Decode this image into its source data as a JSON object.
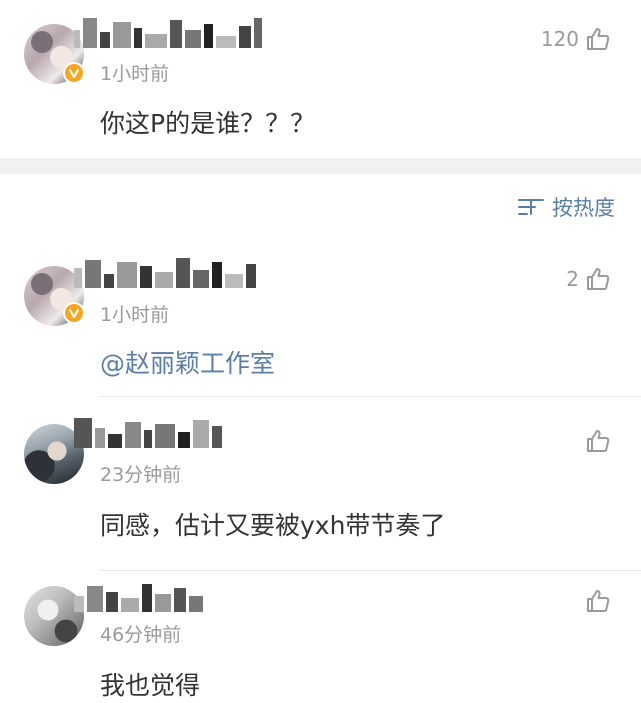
{
  "top_comment": {
    "time": "1小时前",
    "text": "你这P的是谁？？？",
    "likes": "120",
    "verified": true
  },
  "sort": {
    "label": "按热度"
  },
  "replies": [
    {
      "time": "1小时前",
      "text": "@赵丽颖工作室",
      "likes": "2",
      "verified": true
    },
    {
      "time": "23分钟前",
      "text": "同感，估计又要被yxh带节奏了",
      "likes": "",
      "verified": false
    },
    {
      "time": "46分钟前",
      "text": "我也觉得",
      "likes": "",
      "verified": false
    }
  ],
  "colors": {
    "link": "#5b7ea8",
    "muted": "#9a9a9a",
    "text": "#333333",
    "verified_badge": "#f5a623",
    "separator": "#f2f2f2"
  },
  "icons": {
    "like": "thumb-up-icon",
    "sort": "sort-lines-icon",
    "verified": "verified-v-icon"
  }
}
